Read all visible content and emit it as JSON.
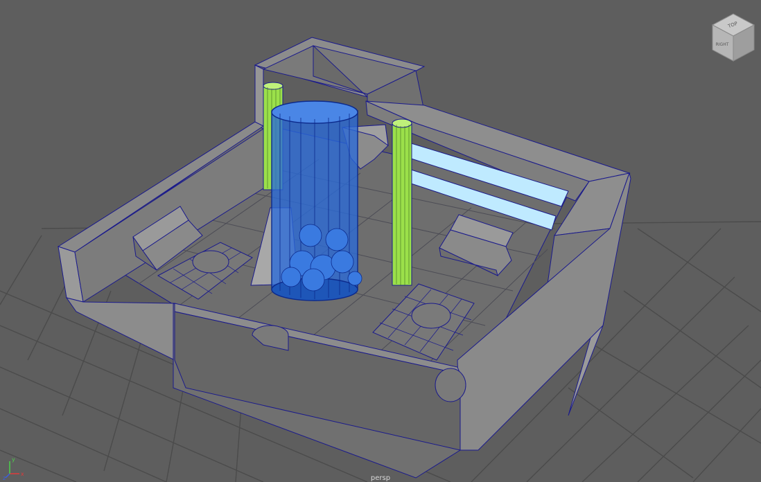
{
  "viewport": {
    "camera_label": "persp",
    "background_color": "#5e5e5e",
    "grid_color": "#4a4a4a",
    "grid_axis_color": "#3a3a3a"
  },
  "viewcube": {
    "top_face_label": "TOP",
    "front_face_label": "RIGHT",
    "icon": "view-cube-icon"
  },
  "axis_indicator": {
    "x_label": "x",
    "y_label": "y",
    "z_label": "z",
    "x_color": "#e03a3a",
    "y_color": "#4cd14c",
    "z_color": "#3a5fe0"
  },
  "scene_objects": {
    "selected_color": "#2a6ad8",
    "active_column_color": "#9be04a",
    "wireframe_color": "#1a1a8c",
    "light_strip_color": "#bfeaff",
    "wall_color": "#8a8a8a",
    "floor_color": "#6c6c6c"
  }
}
